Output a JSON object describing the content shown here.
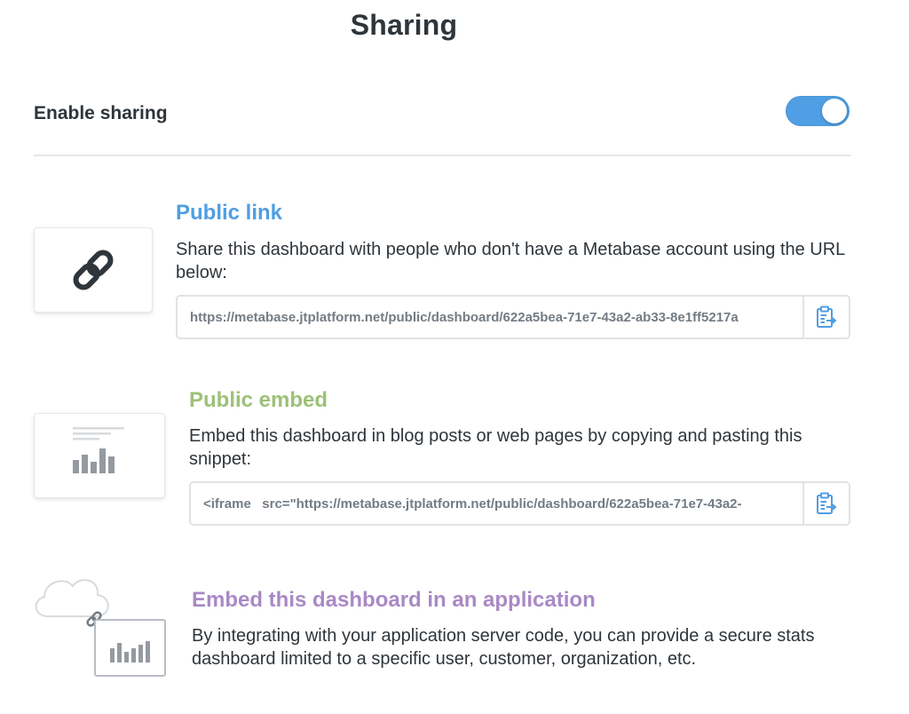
{
  "page": {
    "title": "Sharing"
  },
  "enable_sharing": {
    "label": "Enable sharing",
    "enabled": true,
    "accent_color": "#509ee3"
  },
  "public_link": {
    "title": "Public link",
    "title_color": "#509ee3",
    "description": "Share this dashboard with people who don't have a Metabase account using the URL below:",
    "url": "https://metabase.jtplatform.net/public/dashboard/622a5bea-71e7-43a2-ab33-8e1ff5217a",
    "copy_icon": "clipboard-copy-icon",
    "card_icon": "link-icon"
  },
  "public_embed": {
    "title": "Public embed",
    "title_color": "#9cc177",
    "description": "Embed this dashboard in blog posts or web pages by copying and pasting this snippet:",
    "snippet": "<iframe   src=\"https://metabase.jtplatform.net/public/dashboard/622a5bea-71e7-43a2-",
    "copy_icon": "clipboard-copy-icon",
    "card_icon": "embedded-chart-icon"
  },
  "app_embed": {
    "title": "Embed this dashboard in an application",
    "title_color": "#a989c5",
    "description": "By integrating with your application server code, you can provide a secure stats dashboard limited to a specific user, customer, organization, etc.",
    "card_icon": "cloud-linked-chart-icon"
  }
}
